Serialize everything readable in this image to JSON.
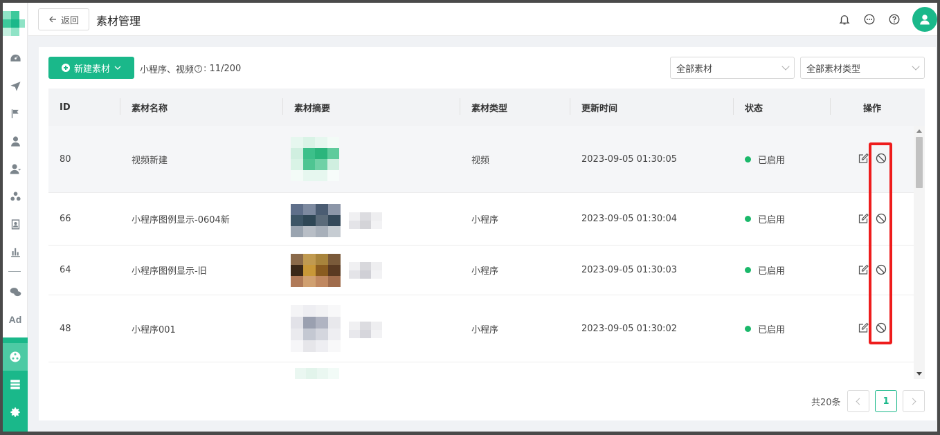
{
  "header": {
    "back_label": "返回",
    "title": "素材管理"
  },
  "toolbar": {
    "new_button_label": "新建素材",
    "quota_prefix": "小程序、视频",
    "quota_value": ": 11/200",
    "filter_scope": "全部素材",
    "filter_type": "全部素材类型"
  },
  "table": {
    "columns": [
      "ID",
      "素材名称",
      "素材摘要",
      "素材类型",
      "更新时间",
      "状态",
      "操作"
    ],
    "rows": [
      {
        "id": "80",
        "name": "视频新建",
        "type": "视频",
        "updated": "2023-09-05 01:30:05",
        "status": "已启用"
      },
      {
        "id": "66",
        "name": "小程序图例显示-0604新",
        "type": "小程序",
        "updated": "2023-09-05 01:30:04",
        "status": "已启用"
      },
      {
        "id": "64",
        "name": "小程序图例显示-旧",
        "type": "小程序",
        "updated": "2023-09-05 01:30:03",
        "status": "已启用"
      },
      {
        "id": "48",
        "name": "小程序001",
        "type": "小程序",
        "updated": "2023-09-05 01:30:02",
        "status": "已启用"
      }
    ]
  },
  "pagination": {
    "total_label": "共20条",
    "current_page": "1"
  },
  "colors": {
    "brand": "#1ab88a",
    "status_enabled": "#1ab86a",
    "highlight": "#ee1c1c"
  },
  "sidebar_icons": [
    "dashboard-icon",
    "send-icon",
    "flag-icon",
    "user-icon",
    "users-icon",
    "group-icon",
    "contact-card-icon",
    "bar-chart-icon",
    "wechat-icon",
    "ad-icon",
    "material-icon",
    "server-icon",
    "settings-icon"
  ]
}
